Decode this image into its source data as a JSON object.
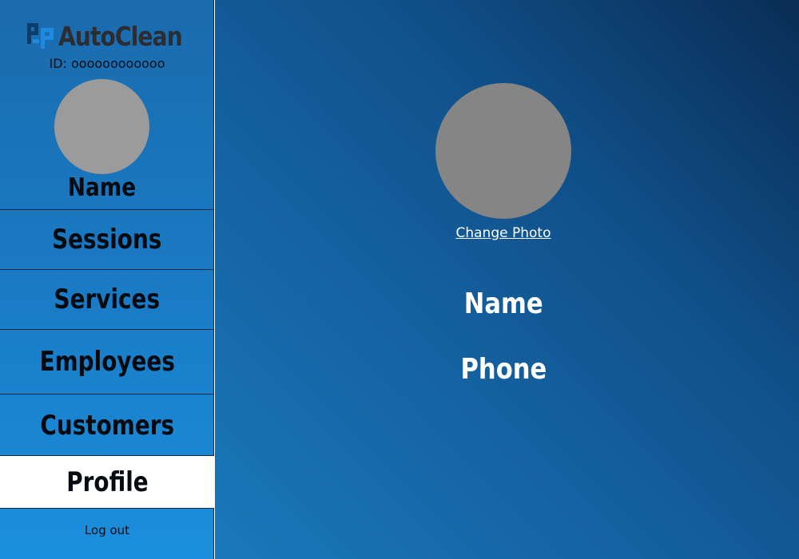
{
  "app": {
    "logo_text": "AutoClean",
    "logo_icon": "autoclean-logo-icon"
  },
  "sidebar": {
    "user_id": "ID: oooooooooooo",
    "name": "Name",
    "items": [
      {
        "label": "Sessions"
      },
      {
        "label": "Services"
      },
      {
        "label": "Employees"
      },
      {
        "label": "Customers"
      },
      {
        "label": "Profile",
        "active": true
      }
    ],
    "logout": "Log out"
  },
  "profile": {
    "change_photo": "Change Photo",
    "name": "Name",
    "phone": "Phone"
  },
  "colors": {
    "sidebar_top": "#1a6bad",
    "sidebar_bottom": "#1b8fdd",
    "main_dark": "#0a2d55",
    "main_light": "#1a78bb",
    "active_item": "#ffffff",
    "avatar": "#9b9b9b"
  }
}
